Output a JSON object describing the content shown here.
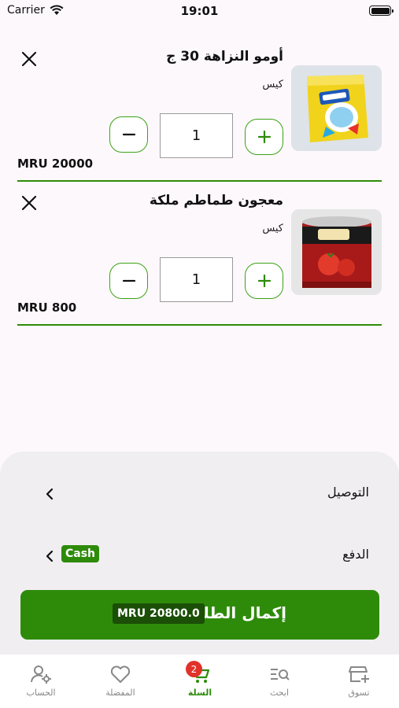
{
  "status_bar": {
    "carrier": "Carrier",
    "time": "19:01"
  },
  "cart": {
    "items": [
      {
        "name": "أومو النزاهة 30 ج",
        "unit": "كيس",
        "quantity": "1",
        "price": "MRU 20000"
      },
      {
        "name": "معجون طماطم ملكة",
        "unit": "كيس",
        "quantity": "1",
        "price": "MRU 800"
      }
    ]
  },
  "summary": {
    "delivery_label": "التوصيل",
    "payment_label": "الدفع",
    "payment_method": "Cash",
    "checkout_label": "إكمال الطلب",
    "total": "MRU 20800.0"
  },
  "nav": {
    "items": [
      {
        "label": "الحساب",
        "icon": "account-settings-icon"
      },
      {
        "label": "المفضلة",
        "icon": "heart-icon"
      },
      {
        "label": "السلة",
        "icon": "cart-icon",
        "badge": "2"
      },
      {
        "label": "ابحث",
        "icon": "search-list-icon"
      },
      {
        "label": "تسوق",
        "icon": "store-icon"
      }
    ]
  },
  "colors": {
    "accent": "#2e8b0a",
    "badge": "#e0322a",
    "background": "#fdf8fc"
  }
}
